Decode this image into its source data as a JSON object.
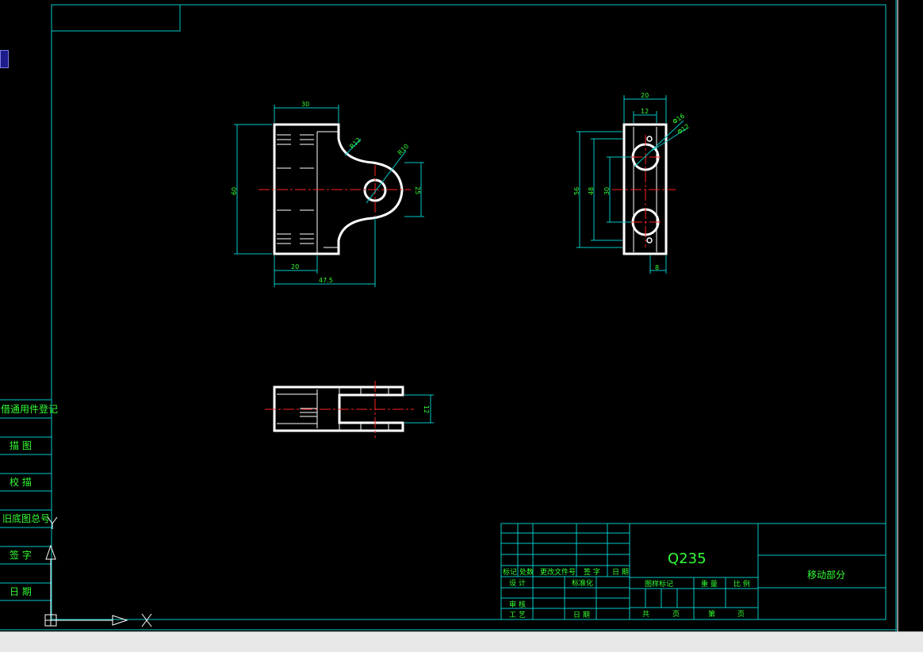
{
  "colors": {
    "background": "#000000",
    "frame": "#00c8c8",
    "outline": "#ffffff",
    "centerline": "#ff2020",
    "text": "#33ff33"
  },
  "left_panel": {
    "labels": [
      "借通用件登记",
      "描 图",
      "校 描",
      "旧底图总号",
      "签 字",
      "日 期"
    ]
  },
  "dims": {
    "front": {
      "width_top": "30",
      "height": "60",
      "bottom_left": "20",
      "overall": "47.5",
      "r1": "R12",
      "r2": "R10",
      "lug": "25"
    },
    "side": {
      "width": "20",
      "inner": "12",
      "h1": "56",
      "h2": "48",
      "h3": "30",
      "bottom": "8",
      "d1": "Φ16",
      "d2": "Φ12"
    },
    "plan": {
      "gap": "12"
    }
  },
  "title_block": {
    "material": "Q235",
    "part_name": "移动部分",
    "row_headers": [
      "标记",
      "处数",
      "更改文件号",
      "签 字",
      "日 期"
    ],
    "design": "设 计",
    "standardize": "标准化",
    "audit": "审 核",
    "process": "工 艺",
    "date": "日 期",
    "stage": "图样标记",
    "weight": "重 量",
    "scale": "比 例",
    "total": "共",
    "sheet_unit": "页",
    "sheet": "第",
    "sheet_unit2": "页"
  },
  "ucs": {
    "x": "X",
    "y": "Y"
  }
}
